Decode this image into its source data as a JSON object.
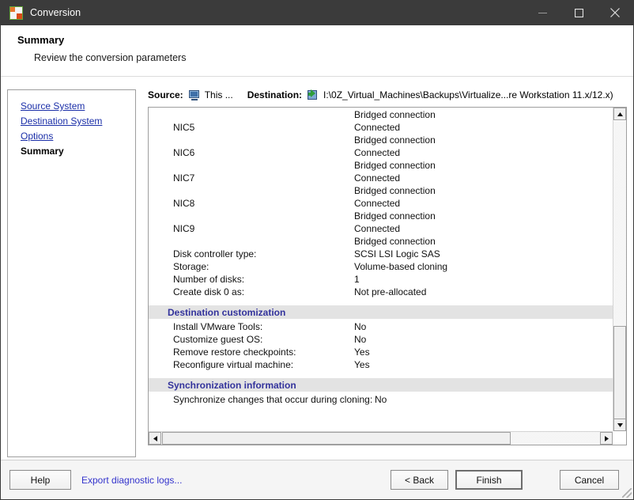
{
  "window": {
    "title": "Conversion",
    "icon": "conversion-app-icon",
    "controls": {
      "minimize": "minimize-icon",
      "maximize": "maximize-icon",
      "close": "close-icon"
    }
  },
  "header": {
    "title": "Summary",
    "subtitle": "Review the conversion parameters"
  },
  "sidebar": {
    "items": [
      {
        "label": "Source System",
        "current": false
      },
      {
        "label": "Destination System",
        "current": false
      },
      {
        "label": "Options",
        "current": false
      },
      {
        "label": "Summary",
        "current": true
      }
    ]
  },
  "source_destination": {
    "source_label": "Source:",
    "source_icon": "computer-monitor-icon",
    "source_value": "This ...",
    "destination_label": "Destination:",
    "destination_icon": "export-arrow-box-icon",
    "destination_value": "I:\\0Z_Virtual_Machines\\Backups\\Virtualize...re Workstation 11.x/12.x)"
  },
  "summary": {
    "top_partial_value": "Bridged connection",
    "nics": [
      {
        "name": "NIC5",
        "status": "Connected",
        "connection": "Bridged connection"
      },
      {
        "name": "NIC6",
        "status": "Connected",
        "connection": "Bridged connection"
      },
      {
        "name": "NIC7",
        "status": "Connected",
        "connection": "Bridged connection"
      },
      {
        "name": "NIC8",
        "status": "Connected",
        "connection": "Bridged connection"
      },
      {
        "name": "NIC9",
        "status": "Connected",
        "connection": "Bridged connection"
      }
    ],
    "disk_rows": [
      {
        "key": "Disk controller type:",
        "value": "SCSI LSI Logic SAS"
      },
      {
        "key": "Storage:",
        "value": "Volume-based cloning"
      },
      {
        "key": "Number of disks:",
        "value": "1"
      },
      {
        "key": "Create disk 0 as:",
        "value": "Not pre-allocated"
      }
    ],
    "destination_customization": {
      "heading": "Destination customization",
      "rows": [
        {
          "key": "Install VMware Tools:",
          "value": "No"
        },
        {
          "key": "Customize guest OS:",
          "value": "No"
        },
        {
          "key": "Remove restore checkpoints:",
          "value": "Yes"
        },
        {
          "key": "Reconfigure virtual machine:",
          "value": "Yes"
        }
      ]
    },
    "synchronization_information": {
      "heading": "Synchronization information",
      "rows": [
        {
          "key": "Synchronize changes that occur during cloning:",
          "value": "No"
        }
      ]
    }
  },
  "scrollbars": {
    "vertical": {
      "up": "scroll-up-icon",
      "down": "scroll-down-icon"
    },
    "horizontal": {
      "left": "scroll-left-icon",
      "right": "scroll-right-icon"
    }
  },
  "footer": {
    "help": "Help",
    "export_logs": "Export diagnostic logs...",
    "back": "< Back",
    "finish": "Finish",
    "cancel": "Cancel"
  },
  "colors": {
    "titlebar": "#3b3b3b",
    "link": "#1a2ea8",
    "section_header_text": "#33339c",
    "section_header_bg": "#e3e3e3",
    "footer_bg": "#f5f5f5"
  }
}
